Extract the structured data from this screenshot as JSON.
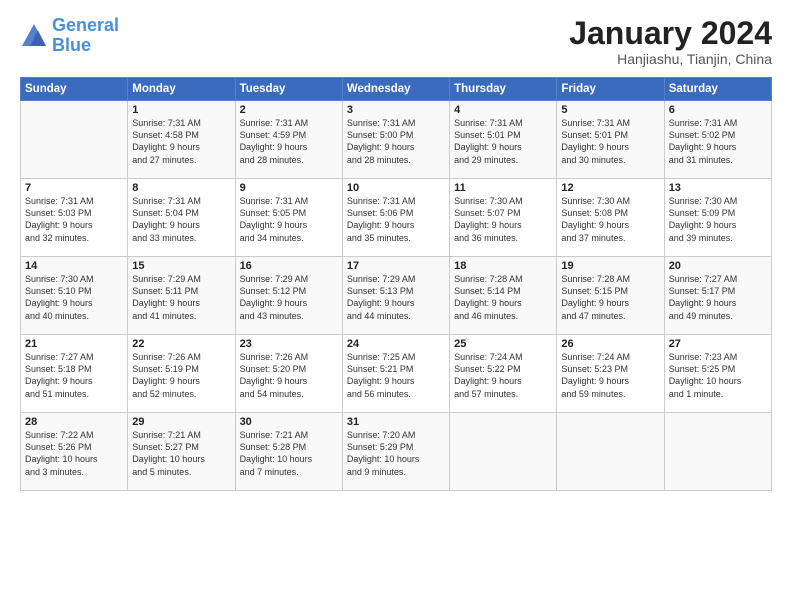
{
  "header": {
    "logo_line1": "General",
    "logo_line2": "Blue",
    "month": "January 2024",
    "location": "Hanjiashu, Tianjin, China"
  },
  "weekdays": [
    "Sunday",
    "Monday",
    "Tuesday",
    "Wednesday",
    "Thursday",
    "Friday",
    "Saturday"
  ],
  "weeks": [
    [
      {
        "day": "",
        "content": ""
      },
      {
        "day": "1",
        "content": "Sunrise: 7:31 AM\nSunset: 4:58 PM\nDaylight: 9 hours\nand 27 minutes."
      },
      {
        "day": "2",
        "content": "Sunrise: 7:31 AM\nSunset: 4:59 PM\nDaylight: 9 hours\nand 28 minutes."
      },
      {
        "day": "3",
        "content": "Sunrise: 7:31 AM\nSunset: 5:00 PM\nDaylight: 9 hours\nand 28 minutes."
      },
      {
        "day": "4",
        "content": "Sunrise: 7:31 AM\nSunset: 5:01 PM\nDaylight: 9 hours\nand 29 minutes."
      },
      {
        "day": "5",
        "content": "Sunrise: 7:31 AM\nSunset: 5:01 PM\nDaylight: 9 hours\nand 30 minutes."
      },
      {
        "day": "6",
        "content": "Sunrise: 7:31 AM\nSunset: 5:02 PM\nDaylight: 9 hours\nand 31 minutes."
      }
    ],
    [
      {
        "day": "7",
        "content": "Sunrise: 7:31 AM\nSunset: 5:03 PM\nDaylight: 9 hours\nand 32 minutes."
      },
      {
        "day": "8",
        "content": "Sunrise: 7:31 AM\nSunset: 5:04 PM\nDaylight: 9 hours\nand 33 minutes."
      },
      {
        "day": "9",
        "content": "Sunrise: 7:31 AM\nSunset: 5:05 PM\nDaylight: 9 hours\nand 34 minutes."
      },
      {
        "day": "10",
        "content": "Sunrise: 7:31 AM\nSunset: 5:06 PM\nDaylight: 9 hours\nand 35 minutes."
      },
      {
        "day": "11",
        "content": "Sunrise: 7:30 AM\nSunset: 5:07 PM\nDaylight: 9 hours\nand 36 minutes."
      },
      {
        "day": "12",
        "content": "Sunrise: 7:30 AM\nSunset: 5:08 PM\nDaylight: 9 hours\nand 37 minutes."
      },
      {
        "day": "13",
        "content": "Sunrise: 7:30 AM\nSunset: 5:09 PM\nDaylight: 9 hours\nand 39 minutes."
      }
    ],
    [
      {
        "day": "14",
        "content": "Sunrise: 7:30 AM\nSunset: 5:10 PM\nDaylight: 9 hours\nand 40 minutes."
      },
      {
        "day": "15",
        "content": "Sunrise: 7:29 AM\nSunset: 5:11 PM\nDaylight: 9 hours\nand 41 minutes."
      },
      {
        "day": "16",
        "content": "Sunrise: 7:29 AM\nSunset: 5:12 PM\nDaylight: 9 hours\nand 43 minutes."
      },
      {
        "day": "17",
        "content": "Sunrise: 7:29 AM\nSunset: 5:13 PM\nDaylight: 9 hours\nand 44 minutes."
      },
      {
        "day": "18",
        "content": "Sunrise: 7:28 AM\nSunset: 5:14 PM\nDaylight: 9 hours\nand 46 minutes."
      },
      {
        "day": "19",
        "content": "Sunrise: 7:28 AM\nSunset: 5:15 PM\nDaylight: 9 hours\nand 47 minutes."
      },
      {
        "day": "20",
        "content": "Sunrise: 7:27 AM\nSunset: 5:17 PM\nDaylight: 9 hours\nand 49 minutes."
      }
    ],
    [
      {
        "day": "21",
        "content": "Sunrise: 7:27 AM\nSunset: 5:18 PM\nDaylight: 9 hours\nand 51 minutes."
      },
      {
        "day": "22",
        "content": "Sunrise: 7:26 AM\nSunset: 5:19 PM\nDaylight: 9 hours\nand 52 minutes."
      },
      {
        "day": "23",
        "content": "Sunrise: 7:26 AM\nSunset: 5:20 PM\nDaylight: 9 hours\nand 54 minutes."
      },
      {
        "day": "24",
        "content": "Sunrise: 7:25 AM\nSunset: 5:21 PM\nDaylight: 9 hours\nand 56 minutes."
      },
      {
        "day": "25",
        "content": "Sunrise: 7:24 AM\nSunset: 5:22 PM\nDaylight: 9 hours\nand 57 minutes."
      },
      {
        "day": "26",
        "content": "Sunrise: 7:24 AM\nSunset: 5:23 PM\nDaylight: 9 hours\nand 59 minutes."
      },
      {
        "day": "27",
        "content": "Sunrise: 7:23 AM\nSunset: 5:25 PM\nDaylight: 10 hours\nand 1 minute."
      }
    ],
    [
      {
        "day": "28",
        "content": "Sunrise: 7:22 AM\nSunset: 5:26 PM\nDaylight: 10 hours\nand 3 minutes."
      },
      {
        "day": "29",
        "content": "Sunrise: 7:21 AM\nSunset: 5:27 PM\nDaylight: 10 hours\nand 5 minutes."
      },
      {
        "day": "30",
        "content": "Sunrise: 7:21 AM\nSunset: 5:28 PM\nDaylight: 10 hours\nand 7 minutes."
      },
      {
        "day": "31",
        "content": "Sunrise: 7:20 AM\nSunset: 5:29 PM\nDaylight: 10 hours\nand 9 minutes."
      },
      {
        "day": "",
        "content": ""
      },
      {
        "day": "",
        "content": ""
      },
      {
        "day": "",
        "content": ""
      }
    ]
  ]
}
